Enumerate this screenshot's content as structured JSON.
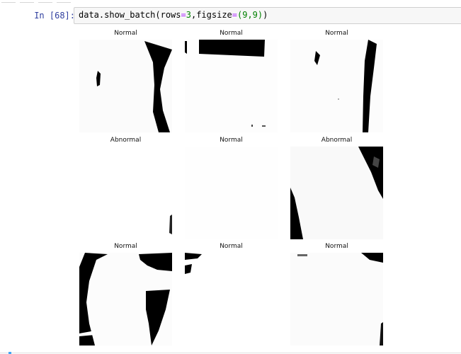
{
  "notebook": {
    "prompt": "In [68]:",
    "code": {
      "fn": "data.show_batch(rows",
      "eq1": "=",
      "rows": "3",
      "mid": ",figsize",
      "eq2": "=",
      "figsize": "(9,9)",
      "close": ")"
    }
  },
  "batch": {
    "panels": [
      {
        "title": "Normal"
      },
      {
        "title": "Normal"
      },
      {
        "title": "Normal"
      },
      {
        "title": "Abnormal"
      },
      {
        "title": "Normal"
      },
      {
        "title": "Abnormal"
      },
      {
        "title": "Normal"
      },
      {
        "title": "Normal"
      },
      {
        "title": "Normal"
      }
    ]
  },
  "colors": {
    "prompt": "#303f9f",
    "operator": "#aa22ff",
    "number": "#008000",
    "input_bg": "#f7f7f7",
    "input_border": "#cfcfcf",
    "active_cell": "#42a5f5"
  }
}
